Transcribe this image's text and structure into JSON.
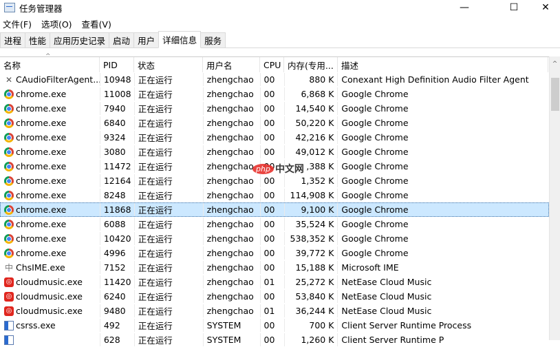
{
  "window": {
    "title": "任务管理器",
    "minimize": "—",
    "maximize": "☐",
    "close": "✕"
  },
  "menu": [
    "文件(F)",
    "选项(O)",
    "查看(V)"
  ],
  "tabs": [
    "进程",
    "性能",
    "应用历史记录",
    "启动",
    "用户",
    "详细信息",
    "服务"
  ],
  "active_tab": "详细信息",
  "columns": [
    "名称",
    "PID",
    "状态",
    "用户名",
    "CPU",
    "内存(专用...",
    "描述"
  ],
  "rows": [
    {
      "icon": "audio",
      "name": "CAudioFilterAgent...",
      "pid": "10948",
      "status": "正在运行",
      "user": "zhengchao",
      "cpu": "00",
      "mem": "880 K",
      "desc": "Conexant High Definition Audio Filter Agent"
    },
    {
      "icon": "chrome",
      "name": "chrome.exe",
      "pid": "11008",
      "status": "正在运行",
      "user": "zhengchao",
      "cpu": "00",
      "mem": "6,868 K",
      "desc": "Google Chrome"
    },
    {
      "icon": "chrome",
      "name": "chrome.exe",
      "pid": "7940",
      "status": "正在运行",
      "user": "zhengchao",
      "cpu": "00",
      "mem": "14,540 K",
      "desc": "Google Chrome"
    },
    {
      "icon": "chrome",
      "name": "chrome.exe",
      "pid": "6840",
      "status": "正在运行",
      "user": "zhengchao",
      "cpu": "00",
      "mem": "50,220 K",
      "desc": "Google Chrome"
    },
    {
      "icon": "chrome",
      "name": "chrome.exe",
      "pid": "9324",
      "status": "正在运行",
      "user": "zhengchao",
      "cpu": "00",
      "mem": "42,216 K",
      "desc": "Google Chrome"
    },
    {
      "icon": "chrome",
      "name": "chrome.exe",
      "pid": "3080",
      "status": "正在运行",
      "user": "zhengchao",
      "cpu": "00",
      "mem": "49,012 K",
      "desc": "Google Chrome"
    },
    {
      "icon": "chrome",
      "name": "chrome.exe",
      "pid": "11472",
      "status": "正在运行",
      "user": "zhengchao",
      "cpu": "00",
      "mem": ",388 K",
      "desc": "Google Chrome"
    },
    {
      "icon": "chrome",
      "name": "chrome.exe",
      "pid": "12164",
      "status": "正在运行",
      "user": "zhengchao",
      "cpu": "00",
      "mem": "1,352 K",
      "desc": "Google Chrome"
    },
    {
      "icon": "chrome",
      "name": "chrome.exe",
      "pid": "8248",
      "status": "正在运行",
      "user": "zhengchao",
      "cpu": "00",
      "mem": "114,908 K",
      "desc": "Google Chrome"
    },
    {
      "icon": "chrome",
      "name": "chrome.exe",
      "pid": "11868",
      "status": "正在运行",
      "user": "zhengchao",
      "cpu": "00",
      "mem": "9,100 K",
      "desc": "Google Chrome",
      "selected": true
    },
    {
      "icon": "chrome",
      "name": "chrome.exe",
      "pid": "6088",
      "status": "正在运行",
      "user": "zhengchao",
      "cpu": "00",
      "mem": "35,524 K",
      "desc": "Google Chrome"
    },
    {
      "icon": "chrome",
      "name": "chrome.exe",
      "pid": "10420",
      "status": "正在运行",
      "user": "zhengchao",
      "cpu": "00",
      "mem": "538,352 K",
      "desc": "Google Chrome"
    },
    {
      "icon": "chrome",
      "name": "chrome.exe",
      "pid": "4996",
      "status": "正在运行",
      "user": "zhengchao",
      "cpu": "00",
      "mem": "39,772 K",
      "desc": "Google Chrome"
    },
    {
      "icon": "ime",
      "name": "ChsIME.exe",
      "pid": "7152",
      "status": "正在运行",
      "user": "zhengchao",
      "cpu": "00",
      "mem": "15,188 K",
      "desc": "Microsoft IME"
    },
    {
      "icon": "music",
      "name": "cloudmusic.exe",
      "pid": "11420",
      "status": "正在运行",
      "user": "zhengchao",
      "cpu": "01",
      "mem": "25,272 K",
      "desc": "NetEase Cloud Music"
    },
    {
      "icon": "music",
      "name": "cloudmusic.exe",
      "pid": "6240",
      "status": "正在运行",
      "user": "zhengchao",
      "cpu": "00",
      "mem": "53,840 K",
      "desc": "NetEase Cloud Music"
    },
    {
      "icon": "music",
      "name": "cloudmusic.exe",
      "pid": "9480",
      "status": "正在运行",
      "user": "zhengchao",
      "cpu": "01",
      "mem": "36,244 K",
      "desc": "NetEase Cloud Music"
    },
    {
      "icon": "csrss",
      "name": "csrss.exe",
      "pid": "492",
      "status": "正在运行",
      "user": "SYSTEM",
      "cpu": "00",
      "mem": "700 K",
      "desc": "Client Server Runtime Process"
    },
    {
      "icon": "csrss",
      "name": "",
      "pid": "628",
      "status": "正在运行",
      "user": "SYSTEM",
      "cpu": "00",
      "mem": "1,260 K",
      "desc": "Client Server Runtime P"
    }
  ],
  "watermark": {
    "logo": "php",
    "text": "中文网"
  }
}
